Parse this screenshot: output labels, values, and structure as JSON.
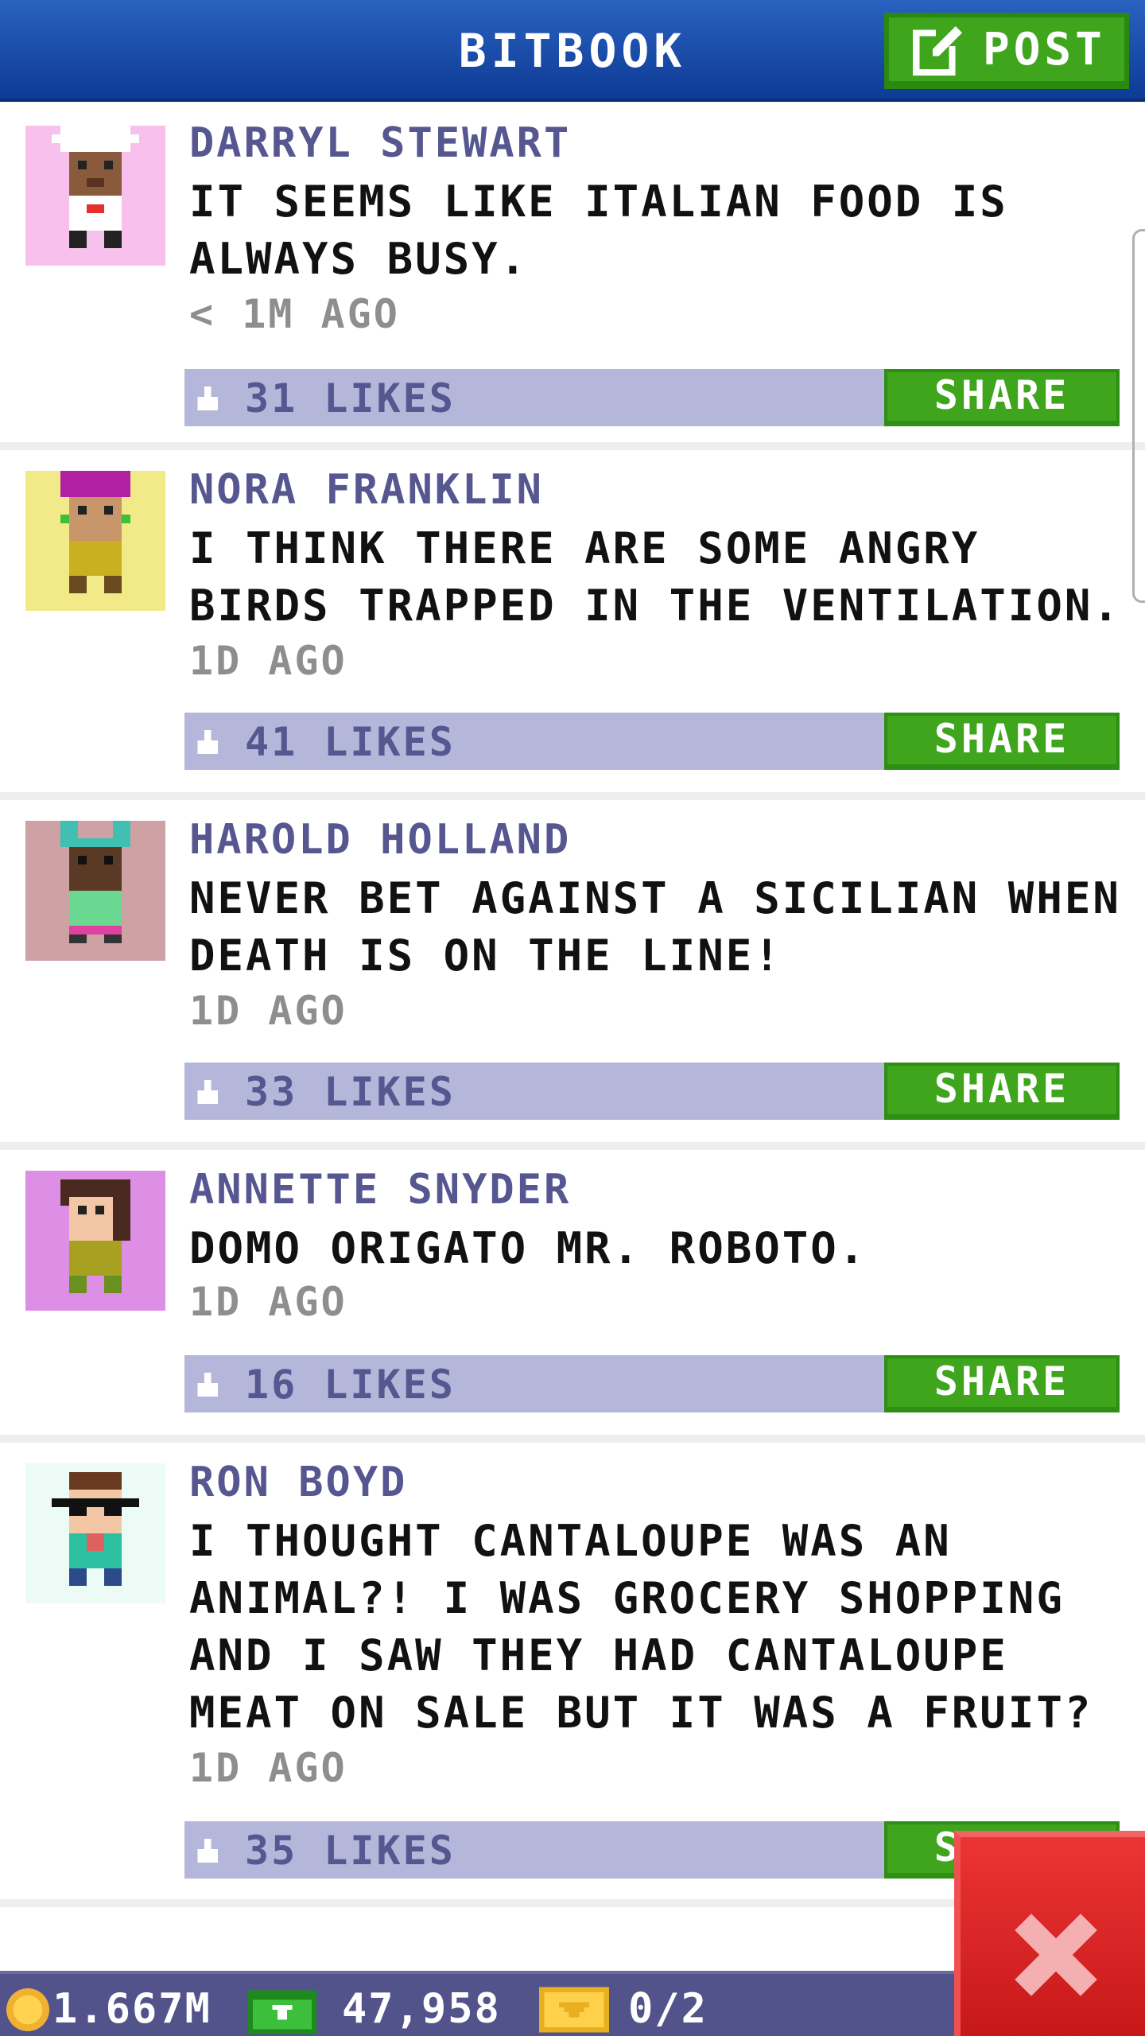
{
  "header": {
    "title": "BITBOOK",
    "post_label": "POST",
    "post_icon": "edit-icon"
  },
  "posts": [
    {
      "author": "DARRYL STEWART",
      "message": "IT SEEMS LIKE ITALIAN FOOD IS ALWAYS BUSY.",
      "time": "< 1M AGO",
      "likes": "31 LIKES",
      "share_label": "SHARE",
      "avatar_bg": "#f8c0ec",
      "avatar": "chef-avatar"
    },
    {
      "author": "NORA FRANKLIN",
      "message": "I THINK THERE ARE SOME ANGRY BIRDS TRAPPED IN THE VENTILATION.",
      "time": "1D AGO",
      "likes": "41 LIKES",
      "share_label": "SHARE",
      "avatar_bg": "#f2ea88",
      "avatar": "woman-beanie-avatar"
    },
    {
      "author": "HAROLD HOLLAND",
      "message": "NEVER BET AGAINST A SICILIAN WHEN DEATH IS ON THE LINE!",
      "time": "1D AGO",
      "likes": "33 LIKES",
      "share_label": "SHARE",
      "avatar_bg": "#cea1a4",
      "avatar": "cat-ears-avatar"
    },
    {
      "author": "ANNETTE SNYDER",
      "message": "DOMO ORIGATO MR. ROBOTO.",
      "time": "1D AGO",
      "likes": "16 LIKES",
      "share_label": "SHARE",
      "avatar_bg": "#dd8fe6",
      "avatar": "woman-avatar"
    },
    {
      "author": "RON BOYD",
      "message": "I THOUGHT CANTALOUPE WAS AN ANIMAL?! I WAS GROCERY SHOPPING AND I SAW THEY HAD CANTALOUPE MEAT ON SALE BUT IT WAS A FRUIT?",
      "time": "1D AGO",
      "likes": "35 LIKES",
      "share_label": "SHARE",
      "avatar_bg": "#edfbf6",
      "avatar": "sunglasses-avatar"
    }
  ],
  "status": {
    "coins": "1.667M",
    "coins_icon": "coin-icon",
    "bux": "47,958",
    "bux_icon": "cash-icon",
    "tickets": "0/2",
    "tickets_icon": "ticket-icon"
  },
  "close_icon": "close-icon",
  "colors": {
    "header_blue": "#1a4fae",
    "share_green": "#3fa51d",
    "likes_bar": "#b5b7da",
    "author_purple": "#565690",
    "close_red": "#de2727"
  }
}
